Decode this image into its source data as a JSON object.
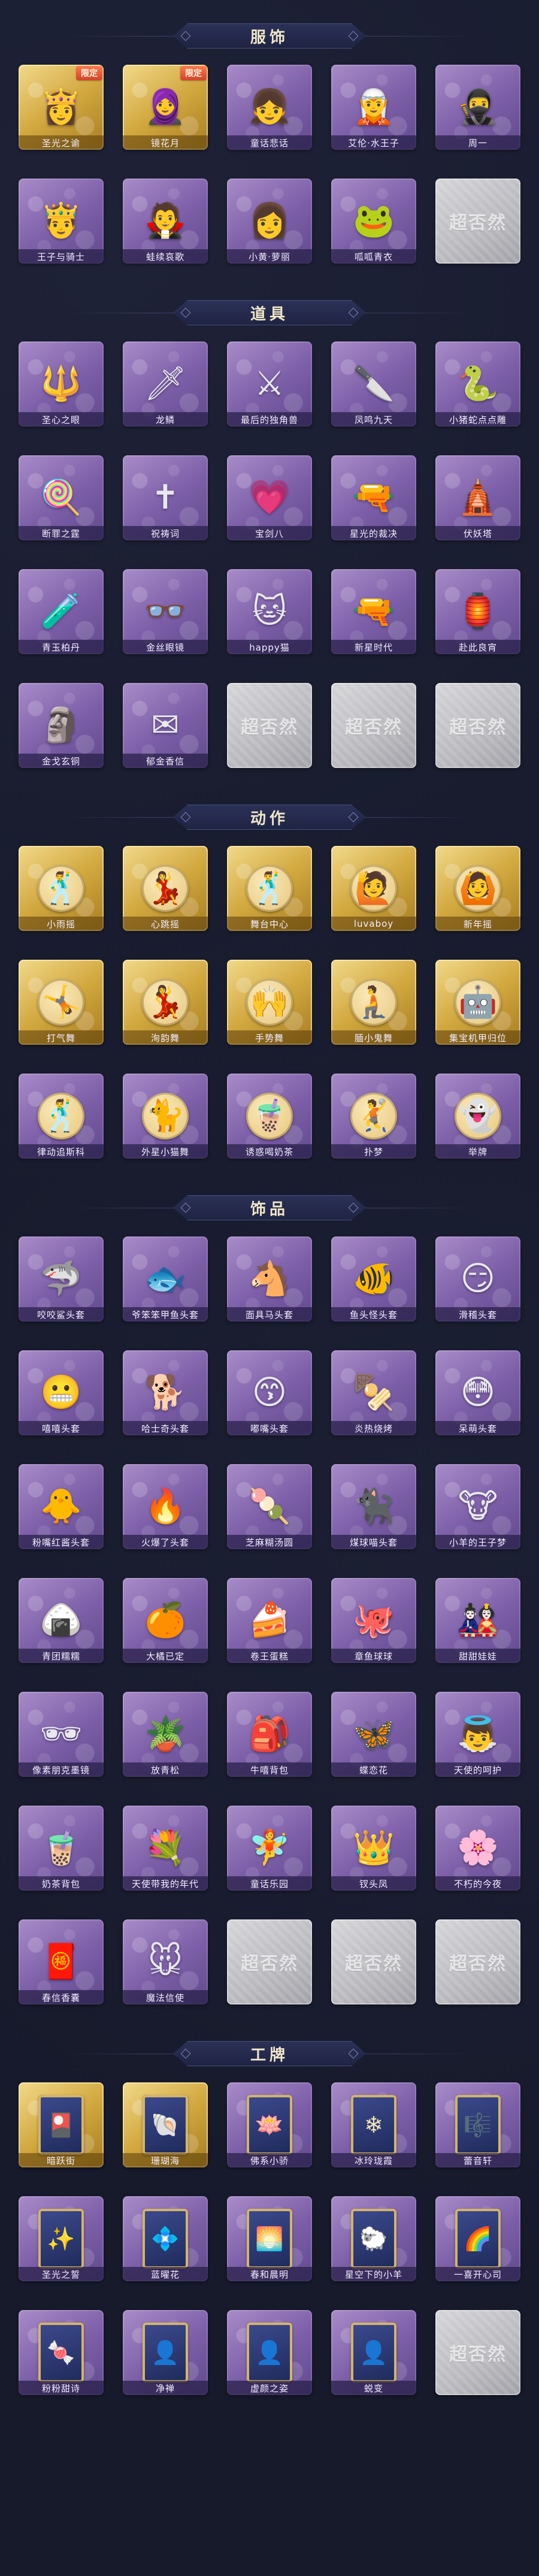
{
  "watermark": "超否然",
  "sections": [
    {
      "key": "clothing",
      "title": "服饰",
      "items": [
        {
          "label": "圣光之谕",
          "style": "gold",
          "icon": "angel-portrait-icon",
          "glyph": "👸",
          "tag": "限定",
          "tag_type": "limit"
        },
        {
          "label": "镜花月",
          "style": "gold",
          "icon": "red-hood-portrait-icon",
          "glyph": "🧕",
          "tag": "限定",
          "tag_type": "limit"
        },
        {
          "label": "童话悲话",
          "style": "purple",
          "icon": "doll-portrait-icon",
          "glyph": "👧",
          "tag": "",
          "tag_type": ""
        },
        {
          "label": "艾伦·水王子",
          "style": "purple",
          "icon": "prince-portrait-icon",
          "glyph": "🧝",
          "tag": "",
          "tag_type": ""
        },
        {
          "label": "周一",
          "style": "purple",
          "icon": "warrior-portrait-icon",
          "glyph": "🥷",
          "tag": "",
          "tag_type": ""
        },
        {
          "label": "王子与骑士",
          "style": "purple",
          "icon": "knight-portrait-icon",
          "glyph": "🤴",
          "tag": "",
          "tag_type": ""
        },
        {
          "label": "蛙续哀歌",
          "style": "purple",
          "icon": "gothic-portrait-icon",
          "glyph": "🧛",
          "tag": "",
          "tag_type": ""
        },
        {
          "label": "小黄·萝丽",
          "style": "purple",
          "icon": "lolita-portrait-icon",
          "glyph": "👩",
          "tag": "",
          "tag_type": ""
        },
        {
          "label": "呱呱青衣",
          "style": "purple",
          "icon": "frog-portrait-icon",
          "glyph": "🐸",
          "tag": "",
          "tag_type": ""
        },
        {
          "label": "",
          "style": "locked",
          "icon": "locked-slot-icon",
          "glyph": "",
          "tag": "",
          "tag_type": ""
        }
      ]
    },
    {
      "key": "props",
      "title": "道具",
      "items": [
        {
          "label": "圣心之眼",
          "style": "purple",
          "icon": "scepter-icon",
          "glyph": "🔱",
          "tag": "",
          "tag_type": ""
        },
        {
          "label": "龙鳞",
          "style": "purple",
          "icon": "golden-spear-icon",
          "glyph": "🗡",
          "tag": "",
          "tag_type": ""
        },
        {
          "label": "最后的独角兽",
          "style": "purple",
          "icon": "crystal-sword-icon",
          "glyph": "⚔",
          "tag": "",
          "tag_type": ""
        },
        {
          "label": "凤鸣九天",
          "style": "purple",
          "icon": "red-blade-icon",
          "glyph": "🔪",
          "tag": "",
          "tag_type": ""
        },
        {
          "label": "小猪蛇点点雕",
          "style": "purple",
          "icon": "snake-figure-icon",
          "glyph": "🐍",
          "tag": "",
          "tag_type": ""
        },
        {
          "label": "断罪之霆",
          "style": "purple",
          "icon": "lollipop-staff-icon",
          "glyph": "🍭",
          "tag": "",
          "tag_type": ""
        },
        {
          "label": "祝祷词",
          "style": "purple",
          "icon": "cross-pendant-icon",
          "glyph": "✝",
          "tag": "",
          "tag_type": ""
        },
        {
          "label": "宝剑八",
          "style": "purple",
          "icon": "heart-mirror-icon",
          "glyph": "💗",
          "tag": "",
          "tag_type": ""
        },
        {
          "label": "星光的裁决",
          "style": "purple",
          "icon": "rifle-icon",
          "glyph": "🔫",
          "tag": "",
          "tag_type": ""
        },
        {
          "label": "伏妖塔",
          "style": "purple",
          "icon": "pagoda-icon",
          "glyph": "🛕",
          "tag": "",
          "tag_type": ""
        },
        {
          "label": "青玉柏丹",
          "style": "purple",
          "icon": "potion-bottle-icon",
          "glyph": "🧪",
          "tag": "",
          "tag_type": ""
        },
        {
          "label": "金丝眼镜",
          "style": "purple",
          "icon": "glasses-icon",
          "glyph": "👓",
          "tag": "",
          "tag_type": ""
        },
        {
          "label": "happy猫",
          "style": "purple",
          "icon": "cat-toy-icon",
          "glyph": "🐱",
          "tag": "",
          "tag_type": ""
        },
        {
          "label": "新星时代",
          "style": "purple",
          "icon": "revolver-icon",
          "glyph": "🔫",
          "tag": "",
          "tag_type": ""
        },
        {
          "label": "赴此良宵",
          "style": "purple",
          "icon": "lantern-icon",
          "glyph": "🏮",
          "tag": "",
          "tag_type": ""
        },
        {
          "label": "金戈玄铜",
          "style": "purple",
          "icon": "bronze-figure-icon",
          "glyph": "🗿",
          "tag": "",
          "tag_type": ""
        },
        {
          "label": "郁金香信",
          "style": "purple",
          "icon": "letter-icon",
          "glyph": "✉",
          "tag": "",
          "tag_type": ""
        },
        {
          "label": "",
          "style": "locked",
          "icon": "locked-slot-icon",
          "glyph": "",
          "tag": "",
          "tag_type": ""
        },
        {
          "label": "",
          "style": "locked",
          "icon": "locked-slot-icon",
          "glyph": "",
          "tag": "",
          "tag_type": ""
        },
        {
          "label": "",
          "style": "locked",
          "icon": "locked-slot-icon",
          "glyph": "",
          "tag": "",
          "tag_type": ""
        }
      ]
    },
    {
      "key": "actions",
      "title": "动作",
      "items": [
        {
          "label": "小雨摇",
          "style": "gold",
          "icon": "dance-pose-icon",
          "glyph": "🕺",
          "tag": "",
          "tag_type": ""
        },
        {
          "label": "心跳摇",
          "style": "gold",
          "icon": "dance-pose-icon",
          "glyph": "💃",
          "tag": "",
          "tag_type": ""
        },
        {
          "label": "舞台中心",
          "style": "gold",
          "icon": "dance-pose-icon",
          "glyph": "🕺",
          "tag": "",
          "tag_type": ""
        },
        {
          "label": "luvaboy",
          "style": "gold",
          "icon": "dance-pose-icon",
          "glyph": "🙋",
          "tag": "",
          "tag_type": ""
        },
        {
          "label": "新年摇",
          "style": "gold",
          "icon": "dance-pose-icon",
          "glyph": "🙆",
          "tag": "",
          "tag_type": ""
        },
        {
          "label": "打气舞",
          "style": "gold",
          "icon": "dance-pose-icon",
          "glyph": "🤸",
          "tag": "",
          "tag_type": ""
        },
        {
          "label": "洵韵舞",
          "style": "gold",
          "icon": "dance-pose-icon",
          "glyph": "💃",
          "tag": "",
          "tag_type": ""
        },
        {
          "label": "手势舞",
          "style": "gold",
          "icon": "dance-pose-icon",
          "glyph": "🙌",
          "tag": "",
          "tag_type": ""
        },
        {
          "label": "腼小鬼舞",
          "style": "gold",
          "icon": "dance-pose-icon",
          "glyph": "🧎",
          "tag": "",
          "tag_type": ""
        },
        {
          "label": "集宝机甲归位",
          "style": "gold",
          "icon": "dance-pose-icon",
          "glyph": "🤖",
          "tag": "",
          "tag_type": ""
        },
        {
          "label": "律动追斯科",
          "style": "purple",
          "icon": "dance-pose-icon",
          "glyph": "🕺",
          "tag": "",
          "tag_type": ""
        },
        {
          "label": "外星小猫舞",
          "style": "purple",
          "icon": "dance-pose-icon",
          "glyph": "🐈",
          "tag": "",
          "tag_type": ""
        },
        {
          "label": "诱惑喝奶茶",
          "style": "purple",
          "icon": "dance-pose-icon",
          "glyph": "🧋",
          "tag": "",
          "tag_type": ""
        },
        {
          "label": "扑梦",
          "style": "purple",
          "icon": "dance-pose-icon",
          "glyph": "🤾",
          "tag": "",
          "tag_type": ""
        },
        {
          "label": "举牌",
          "style": "purple",
          "icon": "ghost-icon",
          "glyph": "👻",
          "tag": "",
          "tag_type": ""
        }
      ]
    },
    {
      "key": "accessories",
      "title": "饰品",
      "items": [
        {
          "label": "咬咬鲨头套",
          "style": "purple",
          "icon": "shark-head-icon",
          "glyph": "🦈",
          "tag": "",
          "tag_type": ""
        },
        {
          "label": "爷笨笨甲鱼头套",
          "style": "purple",
          "icon": "fish-head-icon",
          "glyph": "🐟",
          "tag": "",
          "tag_type": ""
        },
        {
          "label": "面具马头套",
          "style": "purple",
          "icon": "horse-head-icon",
          "glyph": "🐴",
          "tag": "",
          "tag_type": ""
        },
        {
          "label": "鱼头怪头套",
          "style": "purple",
          "icon": "fish-monster-head-icon",
          "glyph": "🐠",
          "tag": "",
          "tag_type": ""
        },
        {
          "label": "滑稽头套",
          "style": "purple",
          "icon": "funny-face-icon",
          "glyph": "😏",
          "tag": "",
          "tag_type": ""
        },
        {
          "label": "嘻嘻头套",
          "style": "purple",
          "icon": "grin-face-icon",
          "glyph": "😬",
          "tag": "",
          "tag_type": ""
        },
        {
          "label": "哈士奇头套",
          "style": "purple",
          "icon": "husky-head-icon",
          "glyph": "🐕",
          "tag": "",
          "tag_type": ""
        },
        {
          "label": "嘟嘴头套",
          "style": "purple",
          "icon": "pout-face-icon",
          "glyph": "😙",
          "tag": "",
          "tag_type": ""
        },
        {
          "label": "炎热烧烤",
          "style": "purple",
          "icon": "grill-icon",
          "glyph": "🍢",
          "tag": "",
          "tag_type": ""
        },
        {
          "label": "呆萌头套",
          "style": "purple",
          "icon": "wide-eyes-face-icon",
          "glyph": "😳",
          "tag": "",
          "tag_type": ""
        },
        {
          "label": "粉嘴红酱头套",
          "style": "purple",
          "icon": "yellow-creature-icon",
          "glyph": "🐥",
          "tag": "",
          "tag_type": ""
        },
        {
          "label": "火爆了头套",
          "style": "purple",
          "icon": "fireball-icon",
          "glyph": "🔥",
          "tag": "",
          "tag_type": ""
        },
        {
          "label": "芝麻糊汤圆",
          "style": "purple",
          "icon": "dumpling-icon",
          "glyph": "🍡",
          "tag": "",
          "tag_type": ""
        },
        {
          "label": "煤球喵头套",
          "style": "purple",
          "icon": "cat-head-icon",
          "glyph": "🐈‍⬛",
          "tag": "",
          "tag_type": ""
        },
        {
          "label": "小羊的王子梦",
          "style": "purple",
          "icon": "cow-head-icon",
          "glyph": "🐮",
          "tag": "",
          "tag_type": ""
        },
        {
          "label": "青团糯糯",
          "style": "purple",
          "icon": "rice-ball-icon",
          "glyph": "🍙",
          "tag": "",
          "tag_type": ""
        },
        {
          "label": "大橘已定",
          "style": "purple",
          "icon": "orange-icon",
          "glyph": "🍊",
          "tag": "",
          "tag_type": ""
        },
        {
          "label": "卷王蛋糕",
          "style": "purple",
          "icon": "roll-cake-icon",
          "glyph": "🍰",
          "tag": "",
          "tag_type": ""
        },
        {
          "label": "章鱼球球",
          "style": "purple",
          "icon": "octopus-icon",
          "glyph": "🐙",
          "tag": "",
          "tag_type": ""
        },
        {
          "label": "甜甜娃娃",
          "style": "purple",
          "icon": "doll-icon",
          "glyph": "🎎",
          "tag": "",
          "tag_type": ""
        },
        {
          "label": "像素朋克墨镜",
          "style": "purple",
          "icon": "pixel-sunglasses-icon",
          "glyph": "🕶",
          "tag": "",
          "tag_type": ""
        },
        {
          "label": "放青松",
          "style": "purple",
          "icon": "pine-plant-icon",
          "glyph": "🪴",
          "tag": "",
          "tag_type": ""
        },
        {
          "label": "牛嘻背包",
          "style": "purple",
          "icon": "backpack-icon",
          "glyph": "🎒",
          "tag": "",
          "tag_type": ""
        },
        {
          "label": "蝶恋花",
          "style": "purple",
          "icon": "butterfly-icon",
          "glyph": "🦋",
          "tag": "",
          "tag_type": ""
        },
        {
          "label": "天使的呵护",
          "style": "purple",
          "icon": "angel-doll-icon",
          "glyph": "👼",
          "tag": "",
          "tag_type": ""
        },
        {
          "label": "奶茶背包",
          "style": "purple",
          "icon": "milk-tea-bag-icon",
          "glyph": "🧋",
          "tag": "",
          "tag_type": ""
        },
        {
          "label": "天使带我的年代",
          "style": "purple",
          "icon": "wreath-icon",
          "glyph": "💐",
          "tag": "",
          "tag_type": ""
        },
        {
          "label": "童话乐园",
          "style": "purple",
          "icon": "fairy-doll-icon",
          "glyph": "🧚",
          "tag": "",
          "tag_type": ""
        },
        {
          "label": "钗头凤",
          "style": "purple",
          "icon": "phoenix-hairpin-icon",
          "glyph": "👑",
          "tag": "",
          "tag_type": ""
        },
        {
          "label": "不朽的今夜",
          "style": "purple",
          "icon": "pink-flower-icon",
          "glyph": "🌸",
          "tag": "",
          "tag_type": ""
        },
        {
          "label": "春信香囊",
          "style": "purple",
          "icon": "sachet-icon",
          "glyph": "🧧",
          "tag": "",
          "tag_type": ""
        },
        {
          "label": "魔法信使",
          "style": "purple",
          "icon": "messenger-mouse-icon",
          "glyph": "🐭",
          "tag": "",
          "tag_type": ""
        },
        {
          "label": "",
          "style": "locked",
          "icon": "locked-slot-icon",
          "glyph": "",
          "tag": "",
          "tag_type": ""
        },
        {
          "label": "",
          "style": "locked",
          "icon": "locked-slot-icon",
          "glyph": "",
          "tag": "",
          "tag_type": ""
        },
        {
          "label": "",
          "style": "locked",
          "icon": "locked-slot-icon",
          "glyph": "",
          "tag": "",
          "tag_type": ""
        }
      ]
    },
    {
      "key": "badges",
      "title": "工牌",
      "items": [
        {
          "label": "暗跃街",
          "style": "gold",
          "icon": "badge-card-icon",
          "glyph": "🎴",
          "tag": "",
          "tag_type": ""
        },
        {
          "label": "珊瑚海",
          "style": "gold",
          "icon": "badge-card-icon",
          "glyph": "🐚",
          "tag": "",
          "tag_type": ""
        },
        {
          "label": "佛系小骄",
          "style": "purple",
          "icon": "badge-card-icon",
          "glyph": "🪷",
          "tag": "",
          "tag_type": ""
        },
        {
          "label": "冰玲珑霞",
          "style": "purple",
          "icon": "badge-card-icon",
          "glyph": "❄",
          "tag": "",
          "tag_type": ""
        },
        {
          "label": "蕾音轩",
          "style": "purple",
          "icon": "badge-card-icon",
          "glyph": "🎼",
          "tag": "",
          "tag_type": ""
        },
        {
          "label": "圣光之誓",
          "style": "purple",
          "icon": "badge-card-icon",
          "glyph": "✨",
          "tag": "",
          "tag_type": ""
        },
        {
          "label": "蓝曜花",
          "style": "purple",
          "icon": "badge-card-icon",
          "glyph": "💠",
          "tag": "",
          "tag_type": ""
        },
        {
          "label": "春和晨明",
          "style": "purple",
          "icon": "badge-card-icon",
          "glyph": "🌅",
          "tag": "",
          "tag_type": ""
        },
        {
          "label": "星空下的小羊",
          "style": "purple",
          "icon": "badge-card-icon",
          "glyph": "🐑",
          "tag": "",
          "tag_type": ""
        },
        {
          "label": "一喜开心司",
          "style": "purple",
          "icon": "badge-card-icon",
          "glyph": "🌈",
          "tag": "",
          "tag_type": ""
        },
        {
          "label": "粉粉甜诗",
          "style": "purple",
          "icon": "badge-card-icon",
          "glyph": "🍬",
          "tag": "",
          "tag_type": ""
        },
        {
          "label": "净禅",
          "style": "purple",
          "icon": "silhouette-card-icon",
          "glyph": "👤",
          "tag": "",
          "tag_type": ""
        },
        {
          "label": "虚颜之姿",
          "style": "purple",
          "icon": "silhouette-card-icon",
          "glyph": "👤",
          "tag": "",
          "tag_type": ""
        },
        {
          "label": "蜕变",
          "style": "purple",
          "icon": "silhouette-card-icon",
          "glyph": "👤",
          "tag": "",
          "tag_type": ""
        },
        {
          "label": "",
          "style": "locked",
          "icon": "locked-slot-icon",
          "glyph": "",
          "tag": "",
          "tag_type": ""
        }
      ]
    }
  ]
}
